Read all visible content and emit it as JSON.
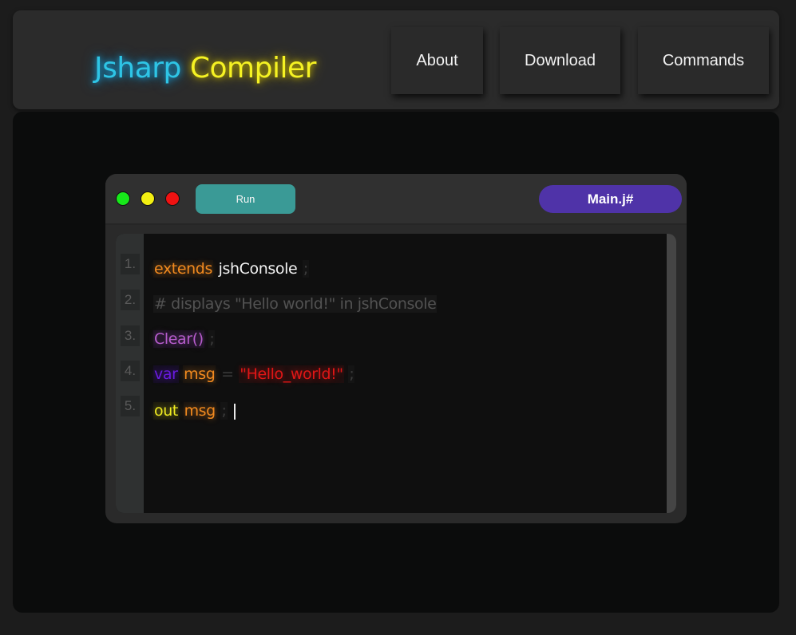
{
  "header": {
    "brand_part1": "Jsharp",
    "brand_part2": "Compiler",
    "nav": [
      {
        "label": "About"
      },
      {
        "label": "Download"
      },
      {
        "label": "Commands"
      }
    ]
  },
  "editor": {
    "window_dots": [
      {
        "name": "green",
        "color": "#17e81a"
      },
      {
        "name": "yellow",
        "color": "#f2ef12"
      },
      {
        "name": "red",
        "color": "#f01212"
      }
    ],
    "run_label": "Run",
    "file_tab": "Main.j#",
    "line_numbers": [
      "1.",
      "2.",
      "3.",
      "4.",
      "5."
    ],
    "lines": [
      {
        "tokens": [
          {
            "text": "extends",
            "kind": "kw-orange"
          },
          {
            "text": "jshConsole",
            "kind": "ident-white"
          },
          {
            "text": ";",
            "kind": "punct"
          }
        ]
      },
      {
        "tokens": [
          {
            "text": "# displays \"Hello world!\" in jshConsole",
            "kind": "comment"
          }
        ]
      },
      {
        "tokens": [
          {
            "text": "Clear()",
            "kind": "fn-purple"
          },
          {
            "text": ";",
            "kind": "punct"
          }
        ]
      },
      {
        "tokens": [
          {
            "text": "var",
            "kind": "kw-violet"
          },
          {
            "text": "msg",
            "kind": "kw-orange"
          },
          {
            "text": "=",
            "kind": "op"
          },
          {
            "text": "\"Hello_world!\"",
            "kind": "str-red"
          },
          {
            "text": ";",
            "kind": "punct"
          }
        ]
      },
      {
        "tokens": [
          {
            "text": "out",
            "kind": "kw-yellow"
          },
          {
            "text": "msg",
            "kind": "kw-orange"
          },
          {
            "text": ";",
            "kind": "punct"
          }
        ]
      }
    ]
  },
  "colors": {
    "page_bg": "#1c1c1c",
    "header_bg": "#2b2b2b",
    "main_bg": "#0b0c0c",
    "run_button": "#3a9a96",
    "file_tab": "#4f33a8"
  }
}
